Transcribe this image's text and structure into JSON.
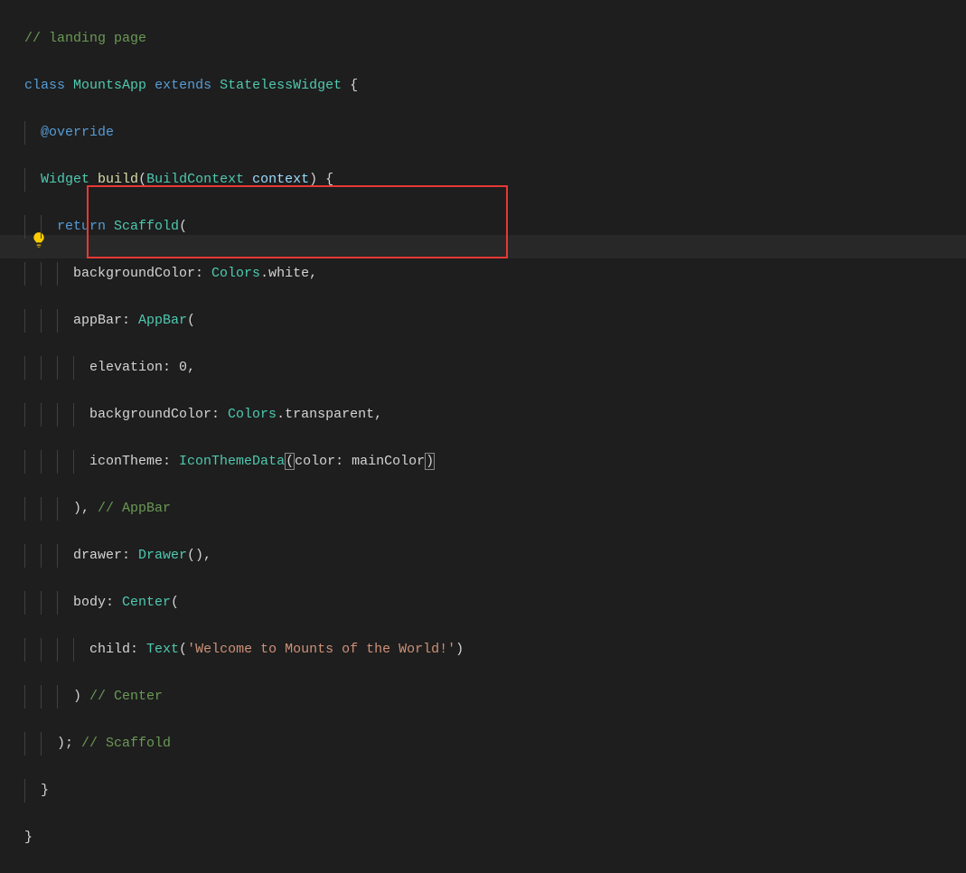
{
  "editor": {
    "lines": {
      "l0_comment": "// landing page",
      "l1_class": "class",
      "l1_name": "MountsApp",
      "l1_extends": "extends",
      "l1_base": "StatelessWidget",
      "l1_brace": " {",
      "l2_annot": "@override",
      "l3_type": "Widget",
      "l3_method": "build",
      "l3_open": "(",
      "l3_ptype": "BuildContext",
      "l3_pname": " context",
      "l3_close": ") {",
      "l4_return": "return",
      "l4_scaffold": "Scaffold",
      "l4_open": "(",
      "l5": "backgroundColor: ",
      "l5_colors": "Colors",
      "l5_rest": ".white,",
      "l6": "appBar: ",
      "l6_appbar": "AppBar",
      "l6_open": "(",
      "l7": "elevation: ",
      "l7_val": "0",
      "l7_comma": ",",
      "l8": "backgroundColor: ",
      "l8_colors": "Colors",
      "l8_rest": ".transparent,",
      "l9": "iconTheme: ",
      "l9_itd": "IconThemeData",
      "l9_open": "(",
      "l9_arg": "color: mainColor",
      "l9_close": ")",
      "l10_close": "), ",
      "l10_comment": "// AppBar",
      "l11": "drawer: ",
      "l11_drawer": "Drawer",
      "l11_rest": "(),",
      "l12": "body: ",
      "l12_center": "Center",
      "l12_open": "(",
      "l13": "child: ",
      "l13_text": "Text",
      "l13_open": "(",
      "l13_str": "'Welcome to Mounts of the World!'",
      "l13_close": ")",
      "l14_close": ") ",
      "l14_comment": "// Center",
      "l15_close": "); ",
      "l15_comment": "// Scaffold",
      "l16_brace": "}",
      "l17_brace": "}"
    }
  },
  "icons": {
    "lightbulb": "lightbulb-icon"
  },
  "colors": {
    "highlight_box": "#e53935",
    "bulb": "#ffcc00"
  }
}
